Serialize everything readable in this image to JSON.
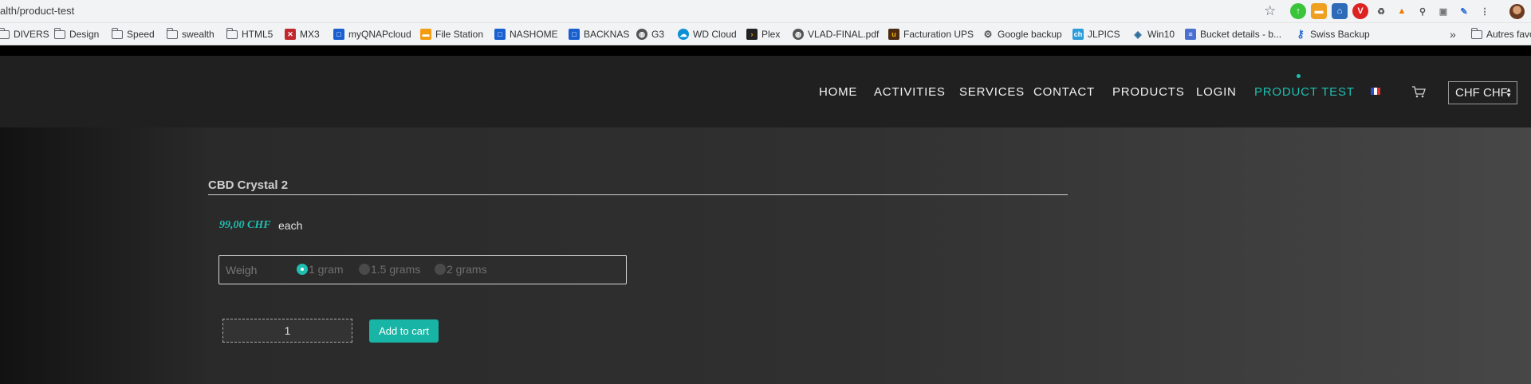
{
  "browser": {
    "url": "alth/product-test",
    "bookmarks": [
      {
        "label": "DIVERS",
        "icon": "folder-icon"
      },
      {
        "label": "Design",
        "icon": "folder-icon"
      },
      {
        "label": "Speed",
        "icon": "folder-icon"
      },
      {
        "label": "swealth",
        "icon": "folder-icon"
      },
      {
        "label": "HTML5",
        "icon": "folder-icon"
      },
      {
        "label": "MX3",
        "icon": "mx3-icon"
      },
      {
        "label": "myQNAPcloud",
        "icon": "qnap-icon"
      },
      {
        "label": "File Station",
        "icon": "file-station-icon"
      },
      {
        "label": "NASHOME",
        "icon": "qnap-icon"
      },
      {
        "label": "BACKNAS",
        "icon": "qnap-icon"
      },
      {
        "label": "G3",
        "icon": "globe-icon"
      },
      {
        "label": "WD Cloud",
        "icon": "wd-cloud-icon"
      },
      {
        "label": "Plex",
        "icon": "plex-icon"
      },
      {
        "label": "VLAD-FINAL.pdf",
        "icon": "globe-icon"
      },
      {
        "label": "Facturation UPS",
        "icon": "ups-icon"
      },
      {
        "label": "Google backup",
        "icon": "gear-icon"
      },
      {
        "label": "JLPICS",
        "icon": "ch-icon"
      },
      {
        "label": "Win10",
        "icon": "cube-icon"
      },
      {
        "label": "Bucket details - b...",
        "icon": "bucket-icon"
      },
      {
        "label": "Swiss Backup",
        "icon": "key-icon"
      }
    ],
    "other_bookmarks": "Autres favoris",
    "more_chevron": "»"
  },
  "nav": {
    "items": [
      "HOME",
      "ACTIVITIES",
      "SERVICES",
      "CONTACT",
      "PRODUCTS",
      "LOGIN",
      "PRODUCT TEST"
    ],
    "active": "PRODUCT TEST",
    "currency": "CHF CHF"
  },
  "product": {
    "title": "CBD Crystal 2",
    "price": "99,00 CHF",
    "unit": "each",
    "weigh_label": "Weigh",
    "options": [
      "1 gram",
      "1.5 grams",
      "2 grams"
    ],
    "selected_option": "1 gram",
    "quantity": "1",
    "add_to_cart": "Add to cart"
  },
  "colors": {
    "accent": "#1ebfb0",
    "navbar": "#202020",
    "page": "#2a2a2a"
  }
}
